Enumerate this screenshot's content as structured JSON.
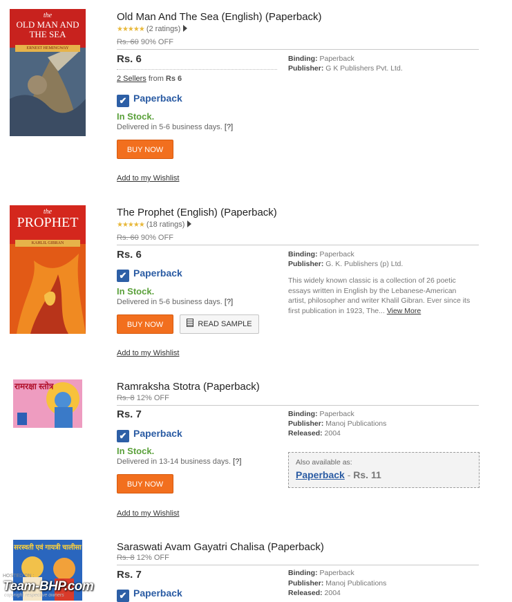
{
  "products": [
    {
      "title": "Old Man And The Sea (English) (Paperback)",
      "stars": "★★★★★",
      "ratings": "(2 ratings)",
      "mrp": "Rs. 60",
      "discount": "90% OFF",
      "price": "Rs. 6",
      "sellers_link": "2 Sellers",
      "sellers_from": "from",
      "sellers_price": "Rs 6",
      "format": "Paperback",
      "stock": "In Stock.",
      "delivery": "Delivered in 5-6 business days.",
      "help": "[?]",
      "buy_label": "BUY NOW",
      "wishlist": "Add to my Wishlist",
      "binding_label": "Binding:",
      "binding": "Paperback",
      "publisher_label": "Publisher:",
      "publisher": "G K Publishers Pvt. Ltd.",
      "cover": {
        "top_text": "the",
        "title_text": "OLD MAN AND THE SEA",
        "author": "ERNEST HEMINGWAY"
      }
    },
    {
      "title": "The Prophet (English) (Paperback)",
      "stars": "★★★★★",
      "ratings": "(18 ratings)",
      "mrp": "Rs. 60",
      "discount": "90% OFF",
      "price": "Rs. 6",
      "format": "Paperback",
      "stock": "In Stock.",
      "delivery": "Delivered in 5-6 business days.",
      "help": "[?]",
      "buy_label": "BUY NOW",
      "sample_label": "READ SAMPLE",
      "wishlist": "Add to my Wishlist",
      "binding_label": "Binding:",
      "binding": "Paperback",
      "publisher_label": "Publisher:",
      "publisher": "G. K. Publishers (p) Ltd.",
      "description": "This widely known classic is a collection of 26 poetic essays written in English by the Lebanese-American artist, philosopher and writer Khalil Gibran. Ever since its first publication in 1923, The...",
      "view_more": "View More",
      "cover": {
        "top_text": "the",
        "title_text": "PROPHET",
        "author": "KAHLIL GIBRAN"
      }
    },
    {
      "title": "Ramraksha Stotra (Paperback)",
      "mrp": "Rs. 8",
      "discount": "12% OFF",
      "price": "Rs. 7",
      "format": "Paperback",
      "stock": "In Stock.",
      "delivery": "Delivered in 13-14 business days.",
      "help": "[?]",
      "buy_label": "BUY NOW",
      "wishlist": "Add to my Wishlist",
      "binding_label": "Binding:",
      "binding": "Paperback",
      "publisher_label": "Publisher:",
      "publisher": "Manoj Publications",
      "released_label": "Released:",
      "released": "2004",
      "also_label": "Also available as:",
      "also_format": "Paperback",
      "also_dash": " - ",
      "also_price": "Rs. 11",
      "cover": {
        "title_text": "रामरक्षा स्तोत्र"
      }
    },
    {
      "title": "Saraswati Avam Gayatri Chalisa (Paperback)",
      "mrp": "Rs. 8",
      "discount": "12% OFF",
      "price": "Rs. 7",
      "format": "Paperback",
      "binding_label": "Binding:",
      "binding": "Paperback",
      "publisher_label": "Publisher:",
      "publisher": "Manoj Publications",
      "released_label": "Released:",
      "released": "2004",
      "cover": {
        "title_text": "सरस्वती एवं गायत्री चालीसा"
      }
    }
  ],
  "watermark": {
    "line1": "HOSTED ON :",
    "brand": "Team-BHP.com",
    "line3": "copyright respective owners"
  }
}
